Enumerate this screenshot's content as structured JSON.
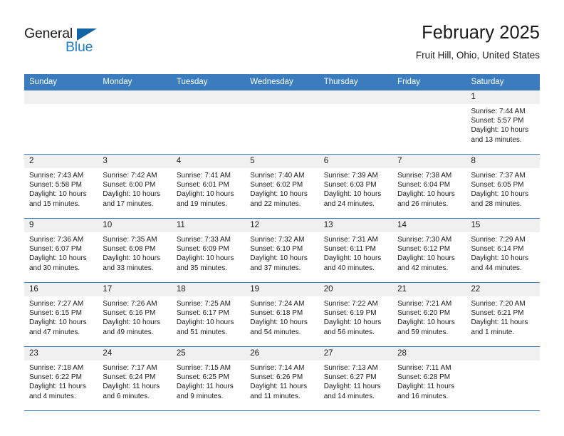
{
  "brand": {
    "name_part1": "General",
    "name_part2": "Blue",
    "accent_color": "#1f7ec4",
    "triangle_color": "#1464a5"
  },
  "header": {
    "title": "February 2025",
    "subtitle": "Fruit Hill, Ohio, United States"
  },
  "theme": {
    "header_row_bg": "#3a7cbe",
    "day_band_bg": "#f0f0f0",
    "row_divider": "#3a7cbe"
  },
  "weekdays": [
    "Sunday",
    "Monday",
    "Tuesday",
    "Wednesday",
    "Thursday",
    "Friday",
    "Saturday"
  ],
  "labels": {
    "sunrise": "Sunrise:",
    "sunset": "Sunset:",
    "daylight": "Daylight:"
  },
  "weeks": [
    [
      {
        "day": "",
        "sunrise": "",
        "sunset": "",
        "daylight_line1": "",
        "daylight_line2": ""
      },
      {
        "day": "",
        "sunrise": "",
        "sunset": "",
        "daylight_line1": "",
        "daylight_line2": ""
      },
      {
        "day": "",
        "sunrise": "",
        "sunset": "",
        "daylight_line1": "",
        "daylight_line2": ""
      },
      {
        "day": "",
        "sunrise": "",
        "sunset": "",
        "daylight_line1": "",
        "daylight_line2": ""
      },
      {
        "day": "",
        "sunrise": "",
        "sunset": "",
        "daylight_line1": "",
        "daylight_line2": ""
      },
      {
        "day": "",
        "sunrise": "",
        "sunset": "",
        "daylight_line1": "",
        "daylight_line2": ""
      },
      {
        "day": "1",
        "sunrise": "Sunrise: 7:44 AM",
        "sunset": "Sunset: 5:57 PM",
        "daylight_line1": "Daylight: 10 hours",
        "daylight_line2": "and 13 minutes."
      }
    ],
    [
      {
        "day": "2",
        "sunrise": "Sunrise: 7:43 AM",
        "sunset": "Sunset: 5:58 PM",
        "daylight_line1": "Daylight: 10 hours",
        "daylight_line2": "and 15 minutes."
      },
      {
        "day": "3",
        "sunrise": "Sunrise: 7:42 AM",
        "sunset": "Sunset: 6:00 PM",
        "daylight_line1": "Daylight: 10 hours",
        "daylight_line2": "and 17 minutes."
      },
      {
        "day": "4",
        "sunrise": "Sunrise: 7:41 AM",
        "sunset": "Sunset: 6:01 PM",
        "daylight_line1": "Daylight: 10 hours",
        "daylight_line2": "and 19 minutes."
      },
      {
        "day": "5",
        "sunrise": "Sunrise: 7:40 AM",
        "sunset": "Sunset: 6:02 PM",
        "daylight_line1": "Daylight: 10 hours",
        "daylight_line2": "and 22 minutes."
      },
      {
        "day": "6",
        "sunrise": "Sunrise: 7:39 AM",
        "sunset": "Sunset: 6:03 PM",
        "daylight_line1": "Daylight: 10 hours",
        "daylight_line2": "and 24 minutes."
      },
      {
        "day": "7",
        "sunrise": "Sunrise: 7:38 AM",
        "sunset": "Sunset: 6:04 PM",
        "daylight_line1": "Daylight: 10 hours",
        "daylight_line2": "and 26 minutes."
      },
      {
        "day": "8",
        "sunrise": "Sunrise: 7:37 AM",
        "sunset": "Sunset: 6:05 PM",
        "daylight_line1": "Daylight: 10 hours",
        "daylight_line2": "and 28 minutes."
      }
    ],
    [
      {
        "day": "9",
        "sunrise": "Sunrise: 7:36 AM",
        "sunset": "Sunset: 6:07 PM",
        "daylight_line1": "Daylight: 10 hours",
        "daylight_line2": "and 30 minutes."
      },
      {
        "day": "10",
        "sunrise": "Sunrise: 7:35 AM",
        "sunset": "Sunset: 6:08 PM",
        "daylight_line1": "Daylight: 10 hours",
        "daylight_line2": "and 33 minutes."
      },
      {
        "day": "11",
        "sunrise": "Sunrise: 7:33 AM",
        "sunset": "Sunset: 6:09 PM",
        "daylight_line1": "Daylight: 10 hours",
        "daylight_line2": "and 35 minutes."
      },
      {
        "day": "12",
        "sunrise": "Sunrise: 7:32 AM",
        "sunset": "Sunset: 6:10 PM",
        "daylight_line1": "Daylight: 10 hours",
        "daylight_line2": "and 37 minutes."
      },
      {
        "day": "13",
        "sunrise": "Sunrise: 7:31 AM",
        "sunset": "Sunset: 6:11 PM",
        "daylight_line1": "Daylight: 10 hours",
        "daylight_line2": "and 40 minutes."
      },
      {
        "day": "14",
        "sunrise": "Sunrise: 7:30 AM",
        "sunset": "Sunset: 6:12 PM",
        "daylight_line1": "Daylight: 10 hours",
        "daylight_line2": "and 42 minutes."
      },
      {
        "day": "15",
        "sunrise": "Sunrise: 7:29 AM",
        "sunset": "Sunset: 6:14 PM",
        "daylight_line1": "Daylight: 10 hours",
        "daylight_line2": "and 44 minutes."
      }
    ],
    [
      {
        "day": "16",
        "sunrise": "Sunrise: 7:27 AM",
        "sunset": "Sunset: 6:15 PM",
        "daylight_line1": "Daylight: 10 hours",
        "daylight_line2": "and 47 minutes."
      },
      {
        "day": "17",
        "sunrise": "Sunrise: 7:26 AM",
        "sunset": "Sunset: 6:16 PM",
        "daylight_line1": "Daylight: 10 hours",
        "daylight_line2": "and 49 minutes."
      },
      {
        "day": "18",
        "sunrise": "Sunrise: 7:25 AM",
        "sunset": "Sunset: 6:17 PM",
        "daylight_line1": "Daylight: 10 hours",
        "daylight_line2": "and 51 minutes."
      },
      {
        "day": "19",
        "sunrise": "Sunrise: 7:24 AM",
        "sunset": "Sunset: 6:18 PM",
        "daylight_line1": "Daylight: 10 hours",
        "daylight_line2": "and 54 minutes."
      },
      {
        "day": "20",
        "sunrise": "Sunrise: 7:22 AM",
        "sunset": "Sunset: 6:19 PM",
        "daylight_line1": "Daylight: 10 hours",
        "daylight_line2": "and 56 minutes."
      },
      {
        "day": "21",
        "sunrise": "Sunrise: 7:21 AM",
        "sunset": "Sunset: 6:20 PM",
        "daylight_line1": "Daylight: 10 hours",
        "daylight_line2": "and 59 minutes."
      },
      {
        "day": "22",
        "sunrise": "Sunrise: 7:20 AM",
        "sunset": "Sunset: 6:21 PM",
        "daylight_line1": "Daylight: 11 hours",
        "daylight_line2": "and 1 minute."
      }
    ],
    [
      {
        "day": "23",
        "sunrise": "Sunrise: 7:18 AM",
        "sunset": "Sunset: 6:22 PM",
        "daylight_line1": "Daylight: 11 hours",
        "daylight_line2": "and 4 minutes."
      },
      {
        "day": "24",
        "sunrise": "Sunrise: 7:17 AM",
        "sunset": "Sunset: 6:24 PM",
        "daylight_line1": "Daylight: 11 hours",
        "daylight_line2": "and 6 minutes."
      },
      {
        "day": "25",
        "sunrise": "Sunrise: 7:15 AM",
        "sunset": "Sunset: 6:25 PM",
        "daylight_line1": "Daylight: 11 hours",
        "daylight_line2": "and 9 minutes."
      },
      {
        "day": "26",
        "sunrise": "Sunrise: 7:14 AM",
        "sunset": "Sunset: 6:26 PM",
        "daylight_line1": "Daylight: 11 hours",
        "daylight_line2": "and 11 minutes."
      },
      {
        "day": "27",
        "sunrise": "Sunrise: 7:13 AM",
        "sunset": "Sunset: 6:27 PM",
        "daylight_line1": "Daylight: 11 hours",
        "daylight_line2": "and 14 minutes."
      },
      {
        "day": "28",
        "sunrise": "Sunrise: 7:11 AM",
        "sunset": "Sunset: 6:28 PM",
        "daylight_line1": "Daylight: 11 hours",
        "daylight_line2": "and 16 minutes."
      },
      {
        "day": "",
        "sunrise": "",
        "sunset": "",
        "daylight_line1": "",
        "daylight_line2": ""
      }
    ]
  ]
}
